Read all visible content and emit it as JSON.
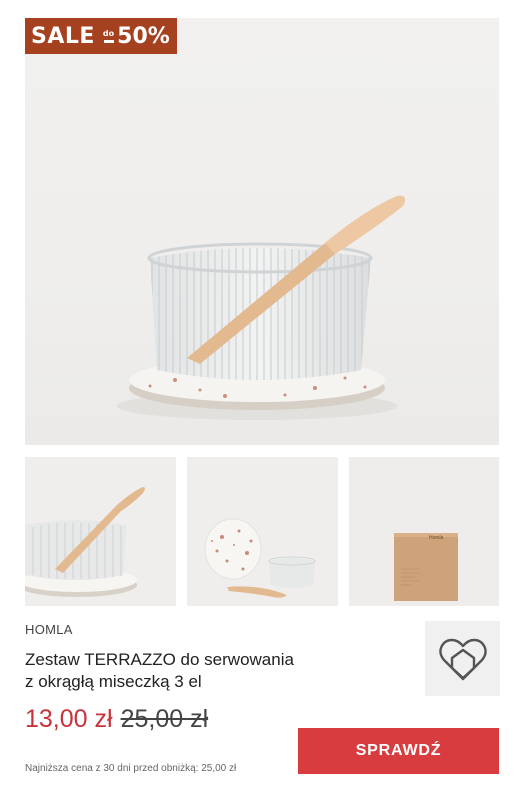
{
  "badge": {
    "sale": "SALE",
    "do": "do",
    "percent": "50%"
  },
  "product": {
    "brand": "HOMLA",
    "title_line1": "Zestaw TERRAZZO do serwowania",
    "title_line2": "z okrągłą miseczką 3 el",
    "price_new": "13,00 zł",
    "price_old": "25,00 zł",
    "lowest_price_note": "Najniższa cena z 30 dni przed obniżką: 25,00 zł"
  },
  "cta": {
    "label": "SPRAWDŹ"
  },
  "thumbnails": [
    {
      "name": "bowl-with-spoon-closeup"
    },
    {
      "name": "coaster-bowl-spoon-flatlay"
    },
    {
      "name": "packaging-box",
      "box_label": "Homla"
    }
  ],
  "logo": {
    "icon": "heart-house-icon"
  },
  "colors": {
    "badge": "#a6411f",
    "price_new": "#c8323a",
    "cta": "#d83c3f"
  }
}
